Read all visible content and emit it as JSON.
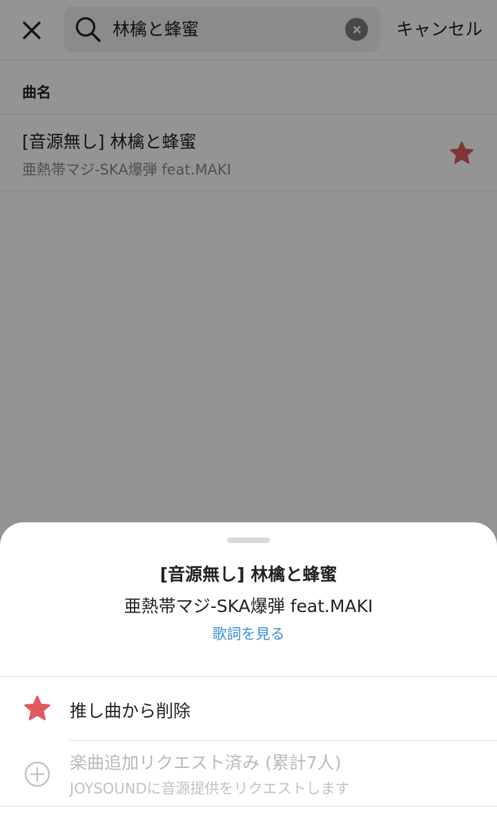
{
  "header": {
    "search_query": "林檎と蜂蜜",
    "cancel_label": "キャンセル"
  },
  "results": {
    "section_title": "曲名",
    "items": [
      {
        "title": "[音源無し] 林檎と蜂蜜",
        "artist": "亜熱帯マジ-SKA爆弾 feat.MAKI",
        "favorited": true
      }
    ]
  },
  "sheet": {
    "title": "[音源無し] 林檎と蜂蜜",
    "artist": "亜熱帯マジ-SKA爆弾 feat.MAKI",
    "lyrics_link": "歌詞を見る",
    "actions": [
      {
        "label": "推し曲から削除",
        "icon": "star-icon",
        "enabled": true
      },
      {
        "label": "楽曲追加リクエスト済み (累計7人)",
        "sublabel": "JOYSOUNDに音源提供をリクエストします",
        "icon": "plus-circle-icon",
        "enabled": false
      }
    ]
  },
  "colors": {
    "accent_star": "#e05a5e",
    "link": "#3a8ed8",
    "text": "#222222",
    "muted": "#8a8a8a",
    "disabled": "#b9b9b9"
  }
}
